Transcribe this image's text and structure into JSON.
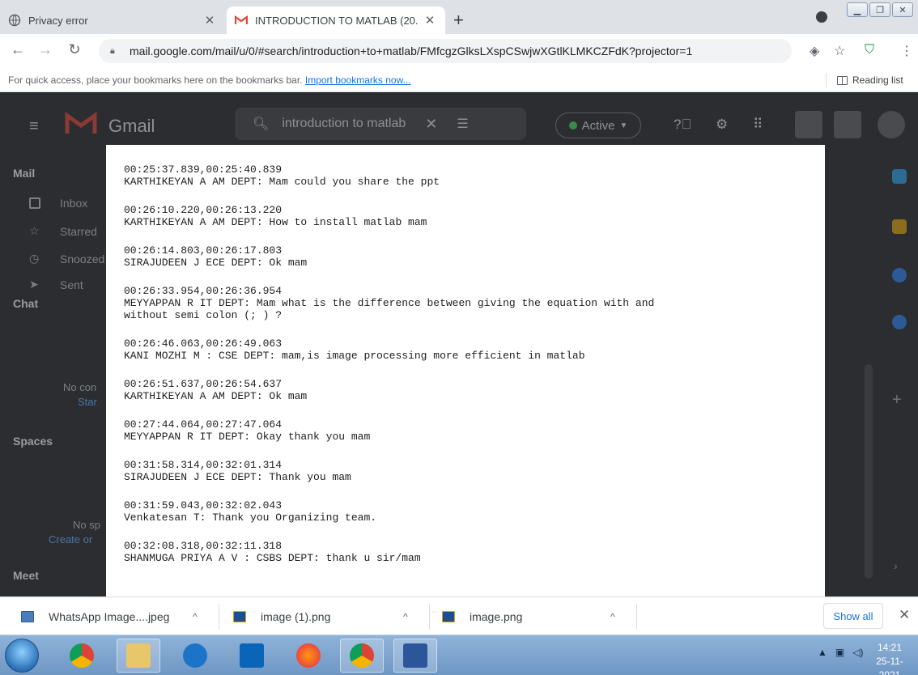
{
  "browser": {
    "tabs": [
      {
        "title": "Privacy error",
        "active": false
      },
      {
        "title": "INTRODUCTION TO MATLAB (20.",
        "active": true
      }
    ],
    "new_tab_symbol": "+",
    "url": "mail.google.com/mail/u/0/#search/introduction+to+matlab/FMfcgzGlksLXspCSwjwXGtlKLMKCZFdK?projector=1",
    "bookmarks_message": "For quick access, place your bookmarks here on the bookmarks bar.",
    "import_bookmarks_link": "Import bookmarks now...",
    "reading_list_label": "Reading list"
  },
  "gmail": {
    "product_name": "Gmail",
    "search_query": "introduction to matlab",
    "status_label": "Active",
    "status_color": "#34a853",
    "nav": {
      "mail_section": "Mail",
      "items": [
        "Inbox",
        "Starred",
        "Snoozed",
        "Sent"
      ],
      "chat_section": "Chat",
      "chat_empty": "No con",
      "chat_start": "Star",
      "spaces_section": "Spaces",
      "spaces_empty": "No sp",
      "spaces_create": "Create or",
      "meet_section": "Meet"
    }
  },
  "transcript": [
    {
      "timestamp": "00:25:37.839,00:25:40.839",
      "message": "KARTHIKEYAN A AM DEPT: Mam could you share the ppt"
    },
    {
      "timestamp": "00:26:10.220,00:26:13.220",
      "message": "KARTHIKEYAN A AM DEPT: How to install matlab mam"
    },
    {
      "timestamp": "00:26:14.803,00:26:17.803",
      "message": "SIRAJUDEEN J ECE DEPT: Ok mam"
    },
    {
      "timestamp": "00:26:33.954,00:26:36.954",
      "message": "MEYYAPPAN R IT DEPT: Mam what is the difference between giving the equation with and\nwithout semi colon (; ) ?"
    },
    {
      "timestamp": "00:26:46.063,00:26:49.063",
      "message": "KANI MOZHI M : CSE DEPT: mam,is image processing more efficient in matlab"
    },
    {
      "timestamp": "00:26:51.637,00:26:54.637",
      "message": "KARTHIKEYAN A AM DEPT: Ok mam"
    },
    {
      "timestamp": "00:27:44.064,00:27:47.064",
      "message": "MEYYAPPAN R IT DEPT: Okay thank you mam"
    },
    {
      "timestamp": "00:31:58.314,00:32:01.314",
      "message": "SIRAJUDEEN J ECE DEPT: Thank you mam"
    },
    {
      "timestamp": "00:31:59.043,00:32:02.043",
      "message": "Venkatesan T: Thank you Organizing team."
    },
    {
      "timestamp": "00:32:08.318,00:32:11.318",
      "message": "SHANMUGA PRIYA A V : CSBS DEPT: thank u sir/mam"
    }
  ],
  "downloads": {
    "items": [
      {
        "name": "WhatsApp Image....jpeg",
        "icon": "image-file-icon"
      },
      {
        "name": "image (1).png",
        "icon": "png-file-icon"
      },
      {
        "name": "image.png",
        "icon": "png-file-icon"
      }
    ],
    "show_all_label": "Show all"
  },
  "taskbar": {
    "apps": [
      "chrome-icon",
      "file-explorer-icon",
      "internet-explorer-icon",
      "outlook-icon",
      "firefox-icon",
      "chrome-icon",
      "word-icon"
    ],
    "time": "14:21",
    "date": "25-11-2021"
  }
}
